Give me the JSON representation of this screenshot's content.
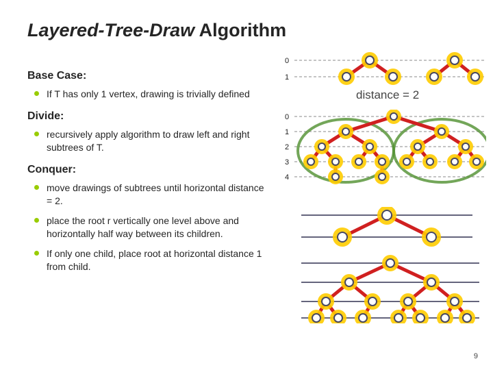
{
  "title_italic": "Layered-Tree-Draw",
  "title_rest": " Algorithm",
  "sections": {
    "base_case": {
      "heading": "Base Case:",
      "items": [
        "If T has only 1 vertex, drawing is trivially defined"
      ]
    },
    "divide": {
      "heading": "Divide:",
      "items": [
        "recursively apply algorithm to draw left and right subtrees of T."
      ]
    },
    "conquer": {
      "heading": "Conquer:",
      "items": [
        "move drawings of subtrees until horizontal distance = 2.",
        "place the root r vertically one level above and horizontally half way between its children.",
        "If only one child, place root at horizontal distance 1 from child."
      ]
    }
  },
  "diagram_labels": {
    "level0": "0",
    "level1": "1",
    "level2": "2",
    "level3": "3",
    "level4": "4",
    "distance_text": "distance = 2"
  },
  "page_number": "9"
}
